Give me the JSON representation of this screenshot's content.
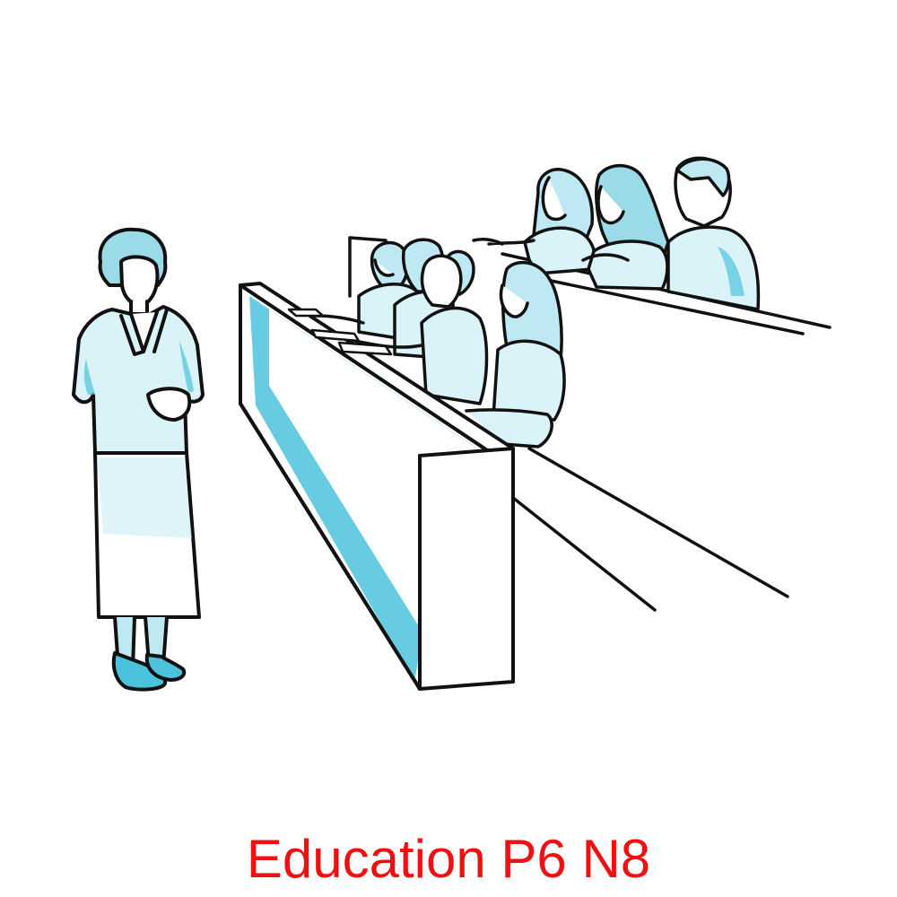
{
  "caption": {
    "text": "Education P6 N8",
    "color": "#ee1111"
  },
  "illustration": {
    "subject": "lecture-hall-scene",
    "colors": {
      "line": "#111111",
      "fill": "#ffffff",
      "shade": "#4cc3dc",
      "background": "#ffffff"
    }
  }
}
